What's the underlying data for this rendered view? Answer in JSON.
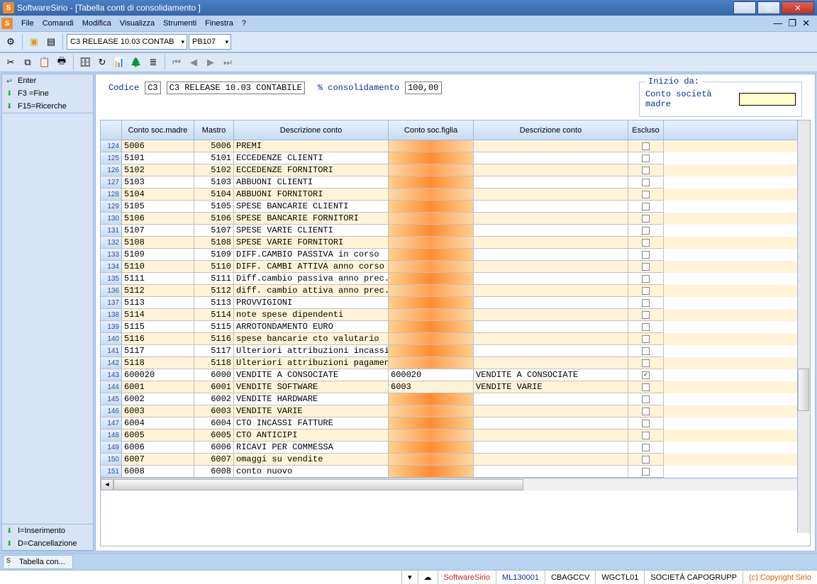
{
  "window": {
    "title": "SoftwareSirio - [Tabella conti di consolidamento ]"
  },
  "menu": [
    "File",
    "Comandi",
    "Modifica",
    "Visualizza",
    "Strumenti",
    "Finestra",
    "?"
  ],
  "toolbar": {
    "combo1": "C3  RELEASE 10.03 CONTAB",
    "combo2": "PB107"
  },
  "left_panel": {
    "top": [
      {
        "label": "Enter",
        "icon": "enter"
      },
      {
        "label": "F3  =Fine",
        "icon": "down"
      },
      {
        "label": "F15=Ricerche",
        "icon": "down"
      }
    ],
    "bottom": [
      {
        "label": "I=Inserimento",
        "icon": "down"
      },
      {
        "label": "D=Cancellazione",
        "icon": "down"
      }
    ]
  },
  "header": {
    "codice_label": "Codice",
    "codice_short": "C3",
    "codice_long": "C3   RELEASE 10.03 CONTABILE",
    "percent_label": "% consolidamento",
    "percent_value": "100,00",
    "fieldset_legend": "Inizio da:",
    "fieldset_label": "Conto società madre"
  },
  "grid": {
    "headers": {
      "rownum": "",
      "csm": "Conto soc.madre",
      "m": "Mastro",
      "dc": "Descrizione conto",
      "csf": "Conto soc.figlia",
      "dc2": "Descrizione conto",
      "esc": "Escluso"
    },
    "rows": [
      {
        "n": "124",
        "csm": "5006",
        "m": "5006",
        "dc": "PREMI",
        "csf": "",
        "dc2": "",
        "esc": false
      },
      {
        "n": "125",
        "csm": "5101",
        "m": "5101",
        "dc": "ECCEDENZE CLIENTI",
        "csf": "",
        "dc2": "",
        "esc": false
      },
      {
        "n": "126",
        "csm": "5102",
        "m": "5102",
        "dc": "ECCEDENZE FORNITORI",
        "csf": "",
        "dc2": "",
        "esc": false
      },
      {
        "n": "127",
        "csm": "5103",
        "m": "5103",
        "dc": "ABBUONI CLIENTI",
        "csf": "",
        "dc2": "",
        "esc": false
      },
      {
        "n": "128",
        "csm": "5104",
        "m": "5104",
        "dc": "ABBUONI FORNITORI",
        "csf": "",
        "dc2": "",
        "esc": false
      },
      {
        "n": "129",
        "csm": "5105",
        "m": "5105",
        "dc": "SPESE BANCARIE CLIENTI",
        "csf": "",
        "dc2": "",
        "esc": false
      },
      {
        "n": "130",
        "csm": "5106",
        "m": "5106",
        "dc": "SPESE BANCARIE FORNITORI",
        "csf": "",
        "dc2": "",
        "esc": false
      },
      {
        "n": "131",
        "csm": "5107",
        "m": "5107",
        "dc": "SPESE VARIE CLIENTI",
        "csf": "",
        "dc2": "",
        "esc": false
      },
      {
        "n": "132",
        "csm": "5108",
        "m": "5108",
        "dc": "SPESE VARIE FORNITORI",
        "csf": "",
        "dc2": "",
        "esc": false
      },
      {
        "n": "133",
        "csm": "5109",
        "m": "5109",
        "dc": "DIFF.CAMBIO PASSIVA in corso",
        "csf": "",
        "dc2": "",
        "esc": false
      },
      {
        "n": "134",
        "csm": "5110",
        "m": "5110",
        "dc": "DIFF. CAMBI ATTIVA anno corso",
        "csf": "",
        "dc2": "",
        "esc": false
      },
      {
        "n": "135",
        "csm": "5111",
        "m": "5111",
        "dc": "Diff.cambio passiva anno prec.",
        "csf": "",
        "dc2": "",
        "esc": false
      },
      {
        "n": "136",
        "csm": "5112",
        "m": "5112",
        "dc": "diff. cambio attiva anno prec.",
        "csf": "",
        "dc2": "",
        "esc": false
      },
      {
        "n": "137",
        "csm": "5113",
        "m": "5113",
        "dc": "PROVVIGIONI",
        "csf": "",
        "dc2": "",
        "esc": false
      },
      {
        "n": "138",
        "csm": "5114",
        "m": "5114",
        "dc": "note spese dipendenti",
        "csf": "",
        "dc2": "",
        "esc": false
      },
      {
        "n": "139",
        "csm": "5115",
        "m": "5115",
        "dc": "ARROTONDAMENTO EURO",
        "csf": "",
        "dc2": "",
        "esc": false
      },
      {
        "n": "140",
        "csm": "5116",
        "m": "5116",
        "dc": "spese bancarie cto valutario",
        "csf": "",
        "dc2": "",
        "esc": false
      },
      {
        "n": "141",
        "csm": "5117",
        "m": "5117",
        "dc": "Ulteriori attribuzioni incassi",
        "csf": "",
        "dc2": "",
        "esc": false
      },
      {
        "n": "142",
        "csm": "5118",
        "m": "5118",
        "dc": "Ulteriori attribuzioni pagamen",
        "csf": "",
        "dc2": "",
        "esc": false
      },
      {
        "n": "143",
        "csm": "600020",
        "m": "6000",
        "dc": "VENDITE A CONSOCIATE",
        "csf": "600020",
        "dc2": "VENDITE A CONSOCIATE",
        "esc": true
      },
      {
        "n": "144",
        "csm": "6001",
        "m": "6001",
        "dc": "VENDITE SOFTWARE",
        "csf": "6003",
        "dc2": "VENDITE VARIE",
        "esc": false
      },
      {
        "n": "145",
        "csm": "6002",
        "m": "6002",
        "dc": "VENDITE HARDWARE",
        "csf": "",
        "dc2": "",
        "esc": false
      },
      {
        "n": "146",
        "csm": "6003",
        "m": "6003",
        "dc": "VENDITE VARIE",
        "csf": "",
        "dc2": "",
        "esc": false
      },
      {
        "n": "147",
        "csm": "6004",
        "m": "6004",
        "dc": "CTO INCASSI FATTURE",
        "csf": "",
        "dc2": "",
        "esc": false
      },
      {
        "n": "148",
        "csm": "6005",
        "m": "6005",
        "dc": "CTO ANTICIPI",
        "csf": "",
        "dc2": "",
        "esc": false
      },
      {
        "n": "149",
        "csm": "6006",
        "m": "6006",
        "dc": "RICAVI PER COMMESSA",
        "csf": "",
        "dc2": "",
        "esc": false
      },
      {
        "n": "150",
        "csm": "6007",
        "m": "6007",
        "dc": "omaggi su vendite",
        "csf": "",
        "dc2": "",
        "esc": false
      },
      {
        "n": "151",
        "csm": "6008",
        "m": "6008",
        "dc": "conto nuovo",
        "csf": "",
        "dc2": "",
        "esc": false
      }
    ]
  },
  "taskbar": {
    "tab1": "Tabella con..."
  },
  "statusbar": {
    "app": "SoftwareSirio",
    "f1": "ML130001",
    "f2": "CBAGCCV",
    "f3": "WGCTL01",
    "f4": "SOCIETÀ CAPOGRUPP",
    "copy": "(c) Copyright Sirio"
  }
}
